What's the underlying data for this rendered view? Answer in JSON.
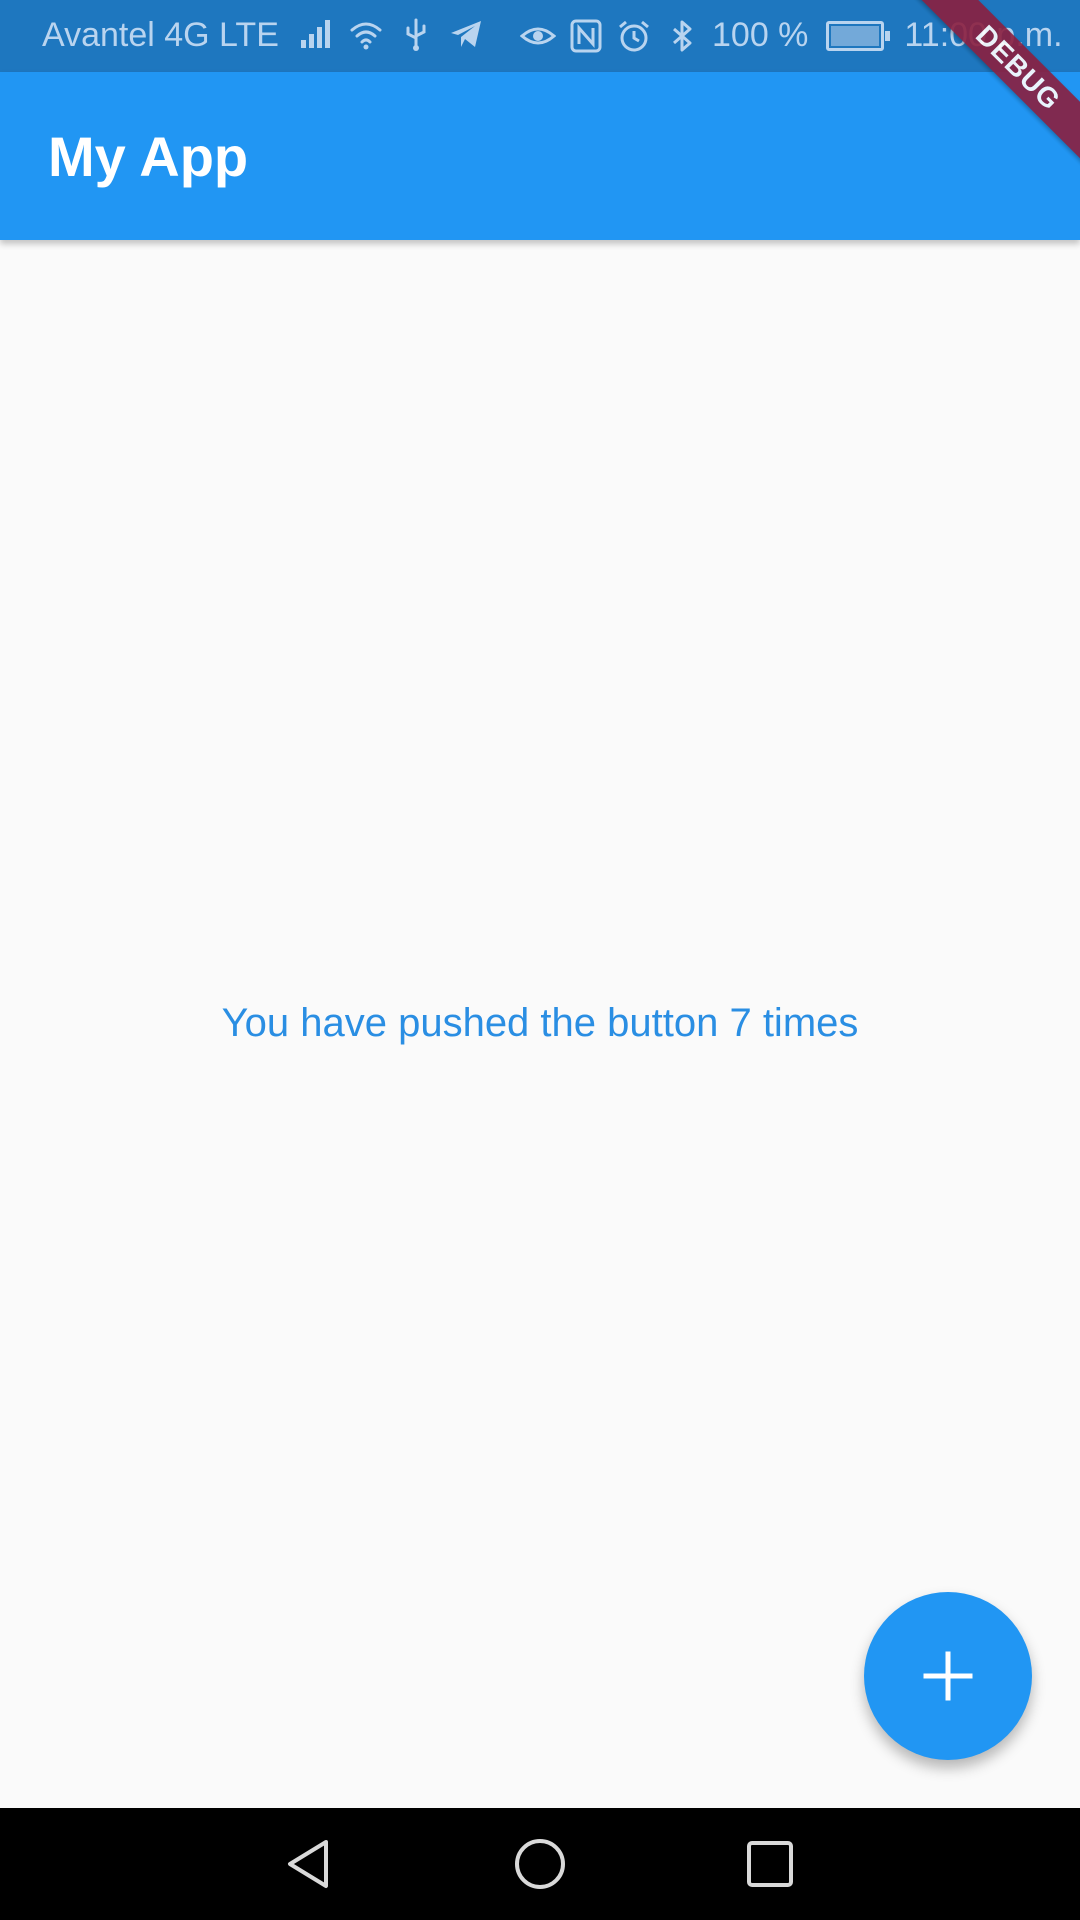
{
  "status_bar": {
    "carrier": "Avantel 4G LTE",
    "battery_level": "100 %",
    "time": "11:00 p.m.",
    "icons": [
      "signal-icon",
      "wifi-icon",
      "usb-icon",
      "telegram-icon",
      "eye-icon",
      "nfc-icon",
      "alarm-icon",
      "bluetooth-icon",
      "battery-charging-icon"
    ]
  },
  "app_bar": {
    "title": "My App"
  },
  "debug_banner": {
    "label": "DEBUG"
  },
  "main": {
    "counter_text": "You have pushed the button 7 times"
  },
  "fab": {
    "icon": "plus-icon"
  },
  "nav_bar": {
    "buttons": [
      "back-icon",
      "home-icon",
      "recents-icon"
    ]
  },
  "colors": {
    "primary": "#2196f3",
    "status_bar": "#1e77bf",
    "background": "#fafafa",
    "counter_text": "#2a8ee3",
    "debug_banner": "#8b1f3f",
    "nav_bar": "#000000"
  }
}
